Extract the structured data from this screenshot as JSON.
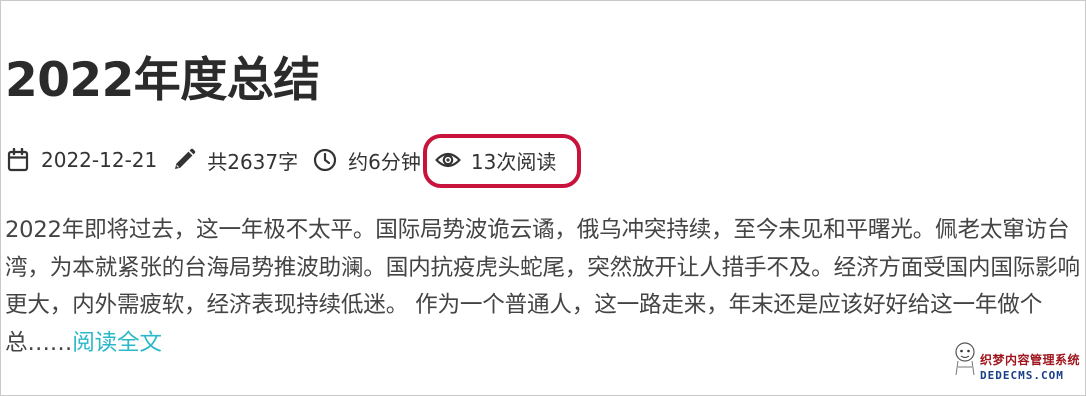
{
  "post": {
    "title": "2022年度总结",
    "meta": {
      "date": "2022-12-21",
      "word_count": "共2637字",
      "read_time": "约6分钟",
      "views": "13次阅读"
    },
    "excerpt": "2022年即将过去，这一年极不太平。国际局势波诡云谲，俄乌冲突持续，至今未见和平曙光。佩老太窜访台湾，为本就紧张的台海局势推波助澜。国内抗疫虎头蛇尾，突然放开让人措手不及。经济方面受国内国际影响更大，内外需疲软，经济表现持续低迷。 作为一个普通人，这一路走来，年末还是应该好好给这一年做个总……",
    "read_more": "阅读全文"
  },
  "icons": {
    "date": "calendar-icon",
    "word_count": "pencil-icon",
    "read_time": "clock-icon",
    "views": "eye-icon"
  },
  "colors": {
    "highlight": "#c8143c",
    "link": "#2bb8c9",
    "text": "#333333"
  },
  "watermark": {
    "cn": "织梦内容管理系统",
    "en": "DEDECMS.COM"
  }
}
